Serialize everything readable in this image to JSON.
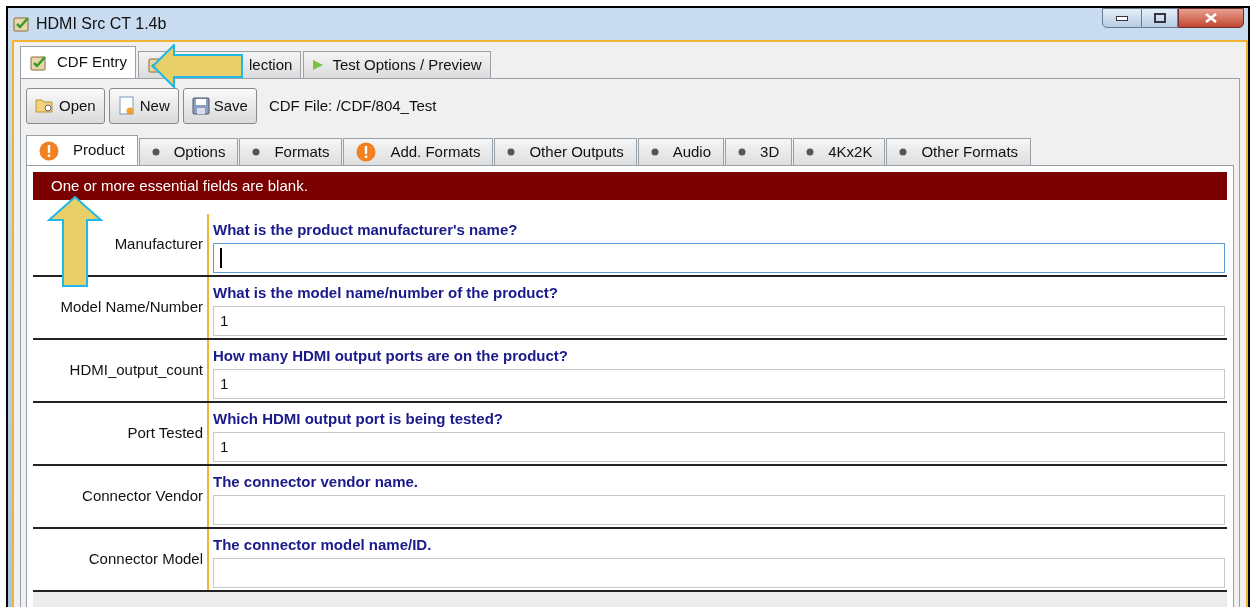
{
  "window": {
    "title": "HDMI Src CT 1.4b"
  },
  "main_tabs": [
    {
      "label": "CDF Entry",
      "selected": true
    },
    {
      "label": "lection",
      "selected": false
    },
    {
      "label": "Test Options / Preview",
      "selected": false
    }
  ],
  "toolbar": {
    "buttons": [
      "Open",
      "New",
      "Save"
    ],
    "file_label": "CDF File: /CDF/804_Test"
  },
  "sub_tabs": [
    {
      "label": "Product",
      "kind": "warning",
      "selected": true
    },
    {
      "label": "Options",
      "kind": "dot",
      "selected": false
    },
    {
      "label": "Formats",
      "kind": "dot",
      "selected": false
    },
    {
      "label": "Add. Formats",
      "kind": "warning",
      "selected": false
    },
    {
      "label": "Other Outputs",
      "kind": "dot",
      "selected": false
    },
    {
      "label": "Audio",
      "kind": "dot",
      "selected": false
    },
    {
      "label": "3D",
      "kind": "dot",
      "selected": false
    },
    {
      "label": "4Kx2K",
      "kind": "dot",
      "selected": false
    },
    {
      "label": "Other Formats",
      "kind": "dot",
      "selected": false
    }
  ],
  "error_banner": "One or more essential fields are blank.",
  "fields": [
    {
      "label": "Manufacturer",
      "question": "What is the product manufacturer's name?",
      "focused": true
    },
    {
      "label": "Model Name/Number",
      "question": "What is the model name/number of the product?",
      "value": "1",
      "focused": false
    },
    {
      "label": "HDMI_output_count",
      "question": "How many HDMI output ports are on the product?",
      "value": "1",
      "focused": false
    },
    {
      "label": "Port Tested",
      "question": "Which HDMI output port is being tested?",
      "value": "1",
      "focused": false
    },
    {
      "label": "Connector Vendor",
      "question": "The connector vendor name.",
      "focused": false
    },
    {
      "label": "Connector Model",
      "question": "The connector model name/ID.",
      "focused": false
    }
  ]
}
